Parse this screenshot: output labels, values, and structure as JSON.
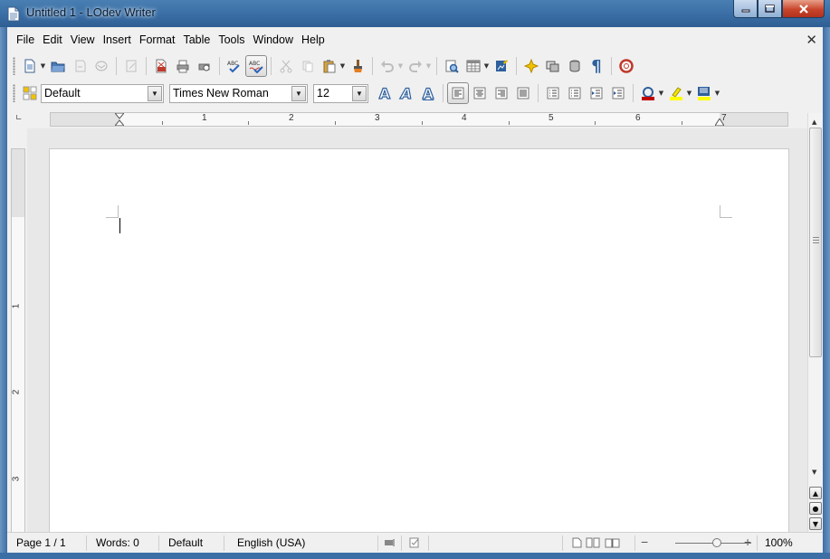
{
  "window": {
    "title": "Untitled 1 - LOdev Writer"
  },
  "menu": [
    "File",
    "Edit",
    "View",
    "Insert",
    "Format",
    "Table",
    "Tools",
    "Window",
    "Help"
  ],
  "formatting": {
    "paragraph_style": "Default",
    "font_name": "Times New Roman",
    "font_size": "12"
  },
  "ruler": {
    "h_numbers": [
      "1",
      "2",
      "3",
      "4",
      "5",
      "6",
      "7"
    ],
    "v_numbers": [
      "1",
      "2",
      "3"
    ]
  },
  "status": {
    "page": "Page 1 / 1",
    "words": "Words: 0",
    "page_style": "Default",
    "language": "English (USA)",
    "zoom": "100%",
    "zoom_level": 100
  },
  "colors": {
    "title_bar": "#3b6fa6",
    "font_color": "#c00000",
    "highlight": "#ffff00"
  }
}
